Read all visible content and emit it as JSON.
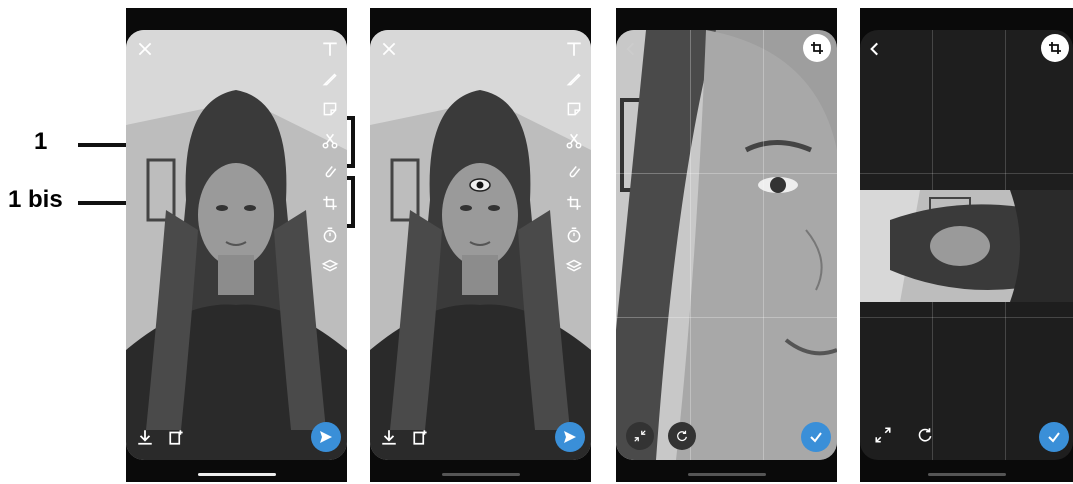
{
  "callouts": [
    {
      "label": "1"
    },
    {
      "label": "1 bis"
    }
  ],
  "colors": {
    "accent_blue": "#3a8fd8",
    "frame_black": "#0a0a0a",
    "icon_white": "#ffffff"
  },
  "icons": {
    "toolbar": [
      "text-icon",
      "pencil-icon",
      "sticker-icon",
      "scissors-icon",
      "paperclip-icon",
      "crop-icon",
      "timer-icon",
      "stack-icon"
    ],
    "bottom": [
      "download-icon",
      "share-story-icon",
      "send-icon"
    ],
    "crop_mode": [
      "back-icon",
      "crop-icon",
      "collapse-icon",
      "rotate-icon",
      "confirm-check-icon",
      "expand-icon"
    ]
  }
}
